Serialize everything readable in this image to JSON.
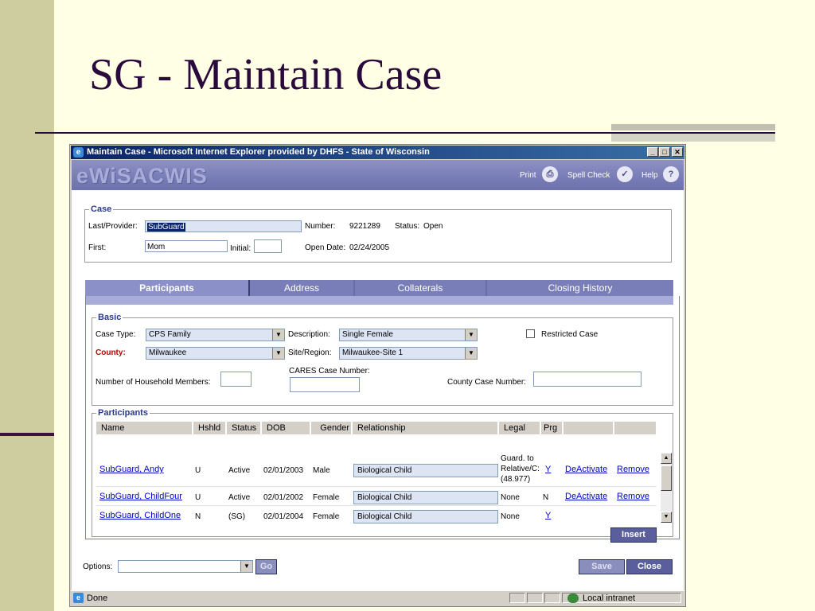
{
  "slide": {
    "title": "SG - Maintain Case"
  },
  "window": {
    "title": "Maintain Case - Microsoft Internet Explorer provided by DHFS - State of Wisconsin",
    "minimize": "_",
    "maximize": "□",
    "close": "✕"
  },
  "banner": {
    "logo": "eWiSACWIS",
    "print": "Print",
    "spell_check": "Spell Check",
    "help": "Help"
  },
  "case": {
    "legend": "Case",
    "last_provider_label": "Last/Provider:",
    "last_provider_value": "SubGuard",
    "first_label": "First:",
    "first_value": "Mom",
    "initial_label": "Initial:",
    "initial_value": "",
    "number_label": "Number:",
    "number_value": "9221289",
    "status_label": "Status:",
    "status_value": "Open",
    "open_date_label": "Open Date:",
    "open_date_value": "02/24/2005"
  },
  "tabs": {
    "participants": "Participants",
    "address": "Address",
    "collaterals": "Collaterals",
    "closing_history": "Closing History"
  },
  "basic": {
    "legend": "Basic",
    "case_type_label": "Case Type:",
    "case_type_value": "CPS Family",
    "description_label": "Description:",
    "description_value": "Single Female",
    "restricted_label": "Restricted Case",
    "county_label": "County:",
    "county_value": "Milwaukee",
    "site_region_label": "Site/Region:",
    "site_region_value": "Milwaukee-Site 1",
    "household_label": "Number of Household Members:",
    "household_value": "",
    "cares_label": "CARES Case Number:",
    "cares_value": "",
    "county_case_label": "County Case Number:",
    "county_case_value": ""
  },
  "participants": {
    "legend": "Participants",
    "headers": [
      "Name",
      "Hshld",
      "Status",
      "DOB",
      "Gender",
      "Relationship",
      "Legal",
      "Prg"
    ],
    "rows": [
      {
        "name": "SubGuard, Andy",
        "hshld": "U",
        "status": "Active",
        "dob": "02/01/2003",
        "gender": "Male",
        "relationship": "Biological Child",
        "legal_1": "Guard. to",
        "legal_2": "Relative/C:",
        "legal_3": "(48.977)",
        "prg": "Y",
        "deactivate": "DeActivate",
        "remove": "Remove"
      },
      {
        "name": "SubGuard, ChildFour",
        "hshld": "U",
        "status": "Active",
        "dob": "02/01/2002",
        "gender": "Female",
        "relationship": "Biological Child",
        "legal": "None",
        "prg": "N",
        "deactivate": "DeActivate",
        "remove": "Remove"
      },
      {
        "name": "SubGuard, ChildOne",
        "hshld": "N",
        "status": "(SG)",
        "dob": "02/01/2004",
        "gender": "Female",
        "relationship": "Biological Child",
        "legal": "None",
        "prg": "Y"
      }
    ],
    "insert": "Insert"
  },
  "footer": {
    "options_label": "Options:",
    "options_value": "",
    "go": "Go",
    "save": "Save",
    "close": "Close"
  },
  "statusbar": {
    "status": "Done",
    "zone": "Local intranet"
  }
}
